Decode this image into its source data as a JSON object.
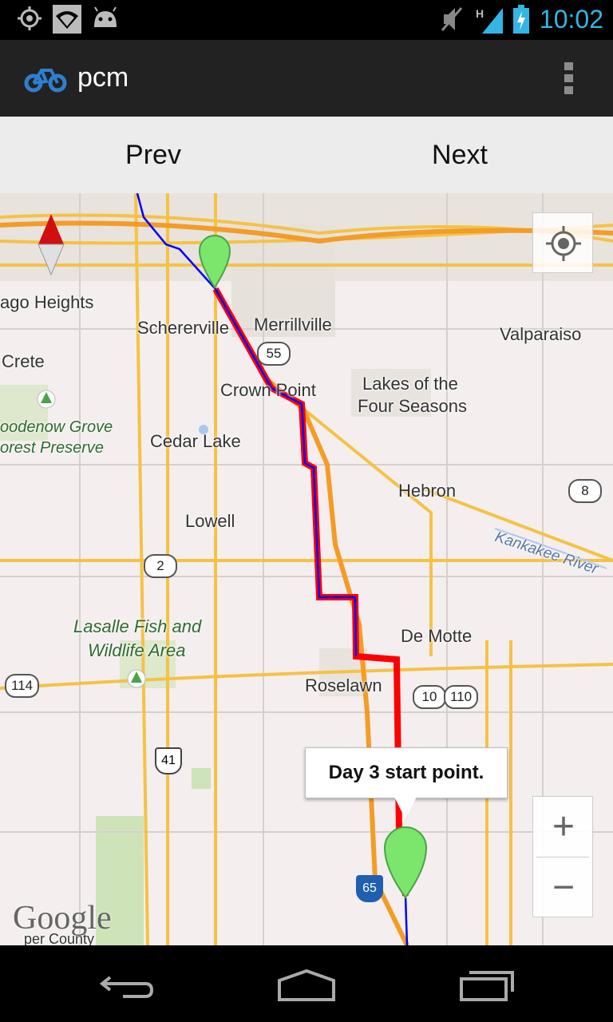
{
  "status_bar": {
    "icons": [
      "gps-icon",
      "wifi-icon",
      "android-icon",
      "mute-icon",
      "signal-icon",
      "battery-charging-icon"
    ],
    "network_type": "H",
    "time": "10:02",
    "time_color": "#33b5e5"
  },
  "action_bar": {
    "title": "pcm",
    "logo_icon": "bicycle-icon",
    "menu_icon": "overflow-menu-icon"
  },
  "nav": {
    "prev_label": "Prev",
    "next_label": "Next"
  },
  "map": {
    "places": {
      "chicago_heights": "ago Heights",
      "schererville": "Schererville",
      "merrillville": "Merrillville",
      "valparaiso": "Valparaiso",
      "crete": "Crete",
      "crown_point": "Crown Point",
      "lakes1": "Lakes of the",
      "lakes2": "Four Seasons",
      "goodenow1": "oodenow Grove",
      "goodenow2": "orest Preserve",
      "cedar_lake": "Cedar Lake",
      "hebron": "Hebron",
      "kankakee": "Kankakee River",
      "lowell": "Lowell",
      "lasalle1": "Lasalle Fish and",
      "lasalle2": "Wildlife Area",
      "de_motte": "De Motte",
      "roselawn": "Roselawn",
      "county": "per County"
    },
    "shields": {
      "r55": "55",
      "r8": "8",
      "r2": "2",
      "r114": "114",
      "r10": "10",
      "r110": "110",
      "r41": "41",
      "r65": "65"
    },
    "callout_text": "Day 3 start point.",
    "route_color": "#ff0000",
    "track_color": "#0000ff",
    "marker_color": "#7be66b",
    "google_logo": "Google",
    "zoom_in": "+",
    "zoom_out": "−"
  }
}
